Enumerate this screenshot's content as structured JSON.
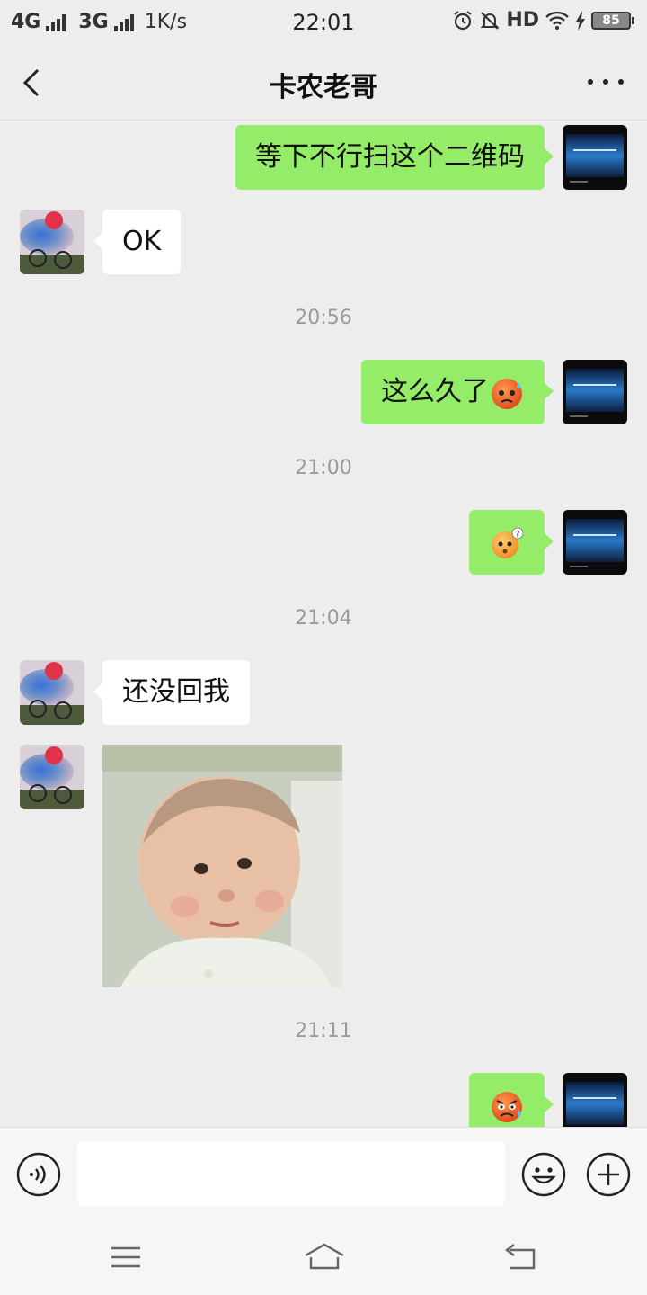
{
  "status_bar": {
    "network1": "4G",
    "network2": "3G",
    "speed": "1K/s",
    "time": "22:01",
    "hd": "HD",
    "battery": "85"
  },
  "header": {
    "title": "卡农老哥"
  },
  "messages": [
    {
      "side": "me",
      "text": "等下不行扫这个二维码"
    },
    {
      "side": "friend",
      "text": "OK"
    },
    {
      "type": "timestamp",
      "text": "20:56"
    },
    {
      "side": "me",
      "text": "这么久了",
      "emoji": "sweat-angry-emoji"
    },
    {
      "type": "timestamp",
      "text": "21:00"
    },
    {
      "side": "me",
      "emoji": "confused-question-emoji"
    },
    {
      "type": "timestamp",
      "text": "21:04"
    },
    {
      "side": "friend",
      "text": "还没回我"
    },
    {
      "side": "friend",
      "image": "baby-photo-sticker"
    },
    {
      "type": "timestamp",
      "text": "21:11"
    },
    {
      "side": "me",
      "emoji": "angry-sweat-emoji"
    }
  ],
  "input_bar": {
    "value": "",
    "placeholder": ""
  },
  "colors": {
    "my_bubble": "#95ec69",
    "friend_bubble": "#ffffff",
    "background": "#ededed"
  }
}
